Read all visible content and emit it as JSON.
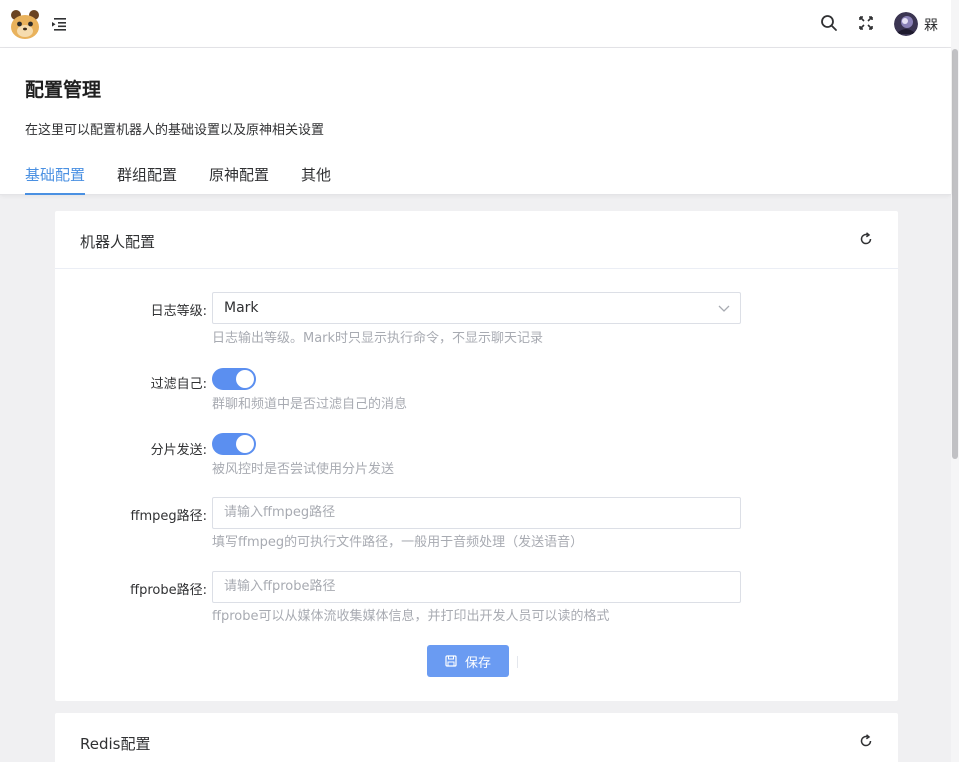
{
  "topbar": {
    "logo_icon": "bear-logo-icon",
    "menu_icon": "menu-fold-icon",
    "search_icon": "search-icon",
    "fullscreen_icon": "fullscreen-icon",
    "username": "槑"
  },
  "header": {
    "title": "配置管理",
    "description": "在这里可以配置机器人的基础设置以及原神相关设置",
    "tabs": [
      {
        "label": "基础配置",
        "active": true
      },
      {
        "label": "群组配置",
        "active": false
      },
      {
        "label": "原神配置",
        "active": false
      },
      {
        "label": "其他",
        "active": false
      }
    ]
  },
  "bot_config": {
    "title": "机器人配置",
    "log_level": {
      "label": "日志等级:",
      "value": "Mark",
      "hint": "日志输出等级。Mark时只显示执行命令，不显示聊天记录"
    },
    "filter_self": {
      "label": "过滤自己:",
      "enabled": true,
      "hint": "群聊和频道中是否过滤自己的消息"
    },
    "split_send": {
      "label": "分片发送:",
      "enabled": true,
      "hint": "被风控时是否尝试使用分片发送"
    },
    "ffmpeg": {
      "label": "ffmpeg路径:",
      "placeholder": "请输入ffmpeg路径",
      "hint": "填写ffmpeg的可执行文件路径，一般用于音频处理（发送语音）"
    },
    "ffprobe": {
      "label": "ffprobe路径:",
      "placeholder": "请输入ffprobe路径",
      "hint": "ffprobe可以从媒体流收集媒体信息，并打印出开发人员可以读的格式"
    },
    "save_label": "保存"
  },
  "redis_config": {
    "title": "Redis配置"
  },
  "colors": {
    "accent": "#4a90e2",
    "button": "#6a9bf2",
    "switch_on": "#5b8ff0"
  }
}
